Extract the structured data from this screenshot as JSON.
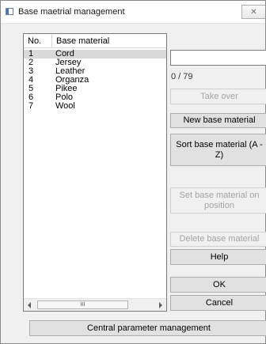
{
  "window": {
    "title": "Base maetrial management",
    "close_glyph": "✕"
  },
  "list": {
    "headers": {
      "no": "No.",
      "material": "Base material"
    },
    "rows": [
      {
        "no": "1",
        "material": "Cord"
      },
      {
        "no": "2",
        "material": "Jersey"
      },
      {
        "no": "3",
        "material": "Leather"
      },
      {
        "no": "4",
        "material": "Organza"
      },
      {
        "no": "5",
        "material": "Pikee"
      },
      {
        "no": "6",
        "material": "Polo"
      },
      {
        "no": "7",
        "material": "Wool"
      }
    ],
    "selected_index": 0,
    "scroll_thumb_grip": "III"
  },
  "name_input": {
    "value": ""
  },
  "counter": "0 / 79",
  "buttons": {
    "take_over": "Take over",
    "new_base_material": "New base material",
    "sort_base_material": "Sort base material (A - Z)",
    "set_base_material_position": "Set base material on position",
    "delete_base_material": "Delete base material",
    "help": "Help",
    "ok": "OK",
    "cancel": "Cancel",
    "central_parameter_management": "Central parameter management"
  },
  "colors": {
    "selected_row": "#d9d9d9",
    "disabled_text": "#a3a3a3"
  }
}
